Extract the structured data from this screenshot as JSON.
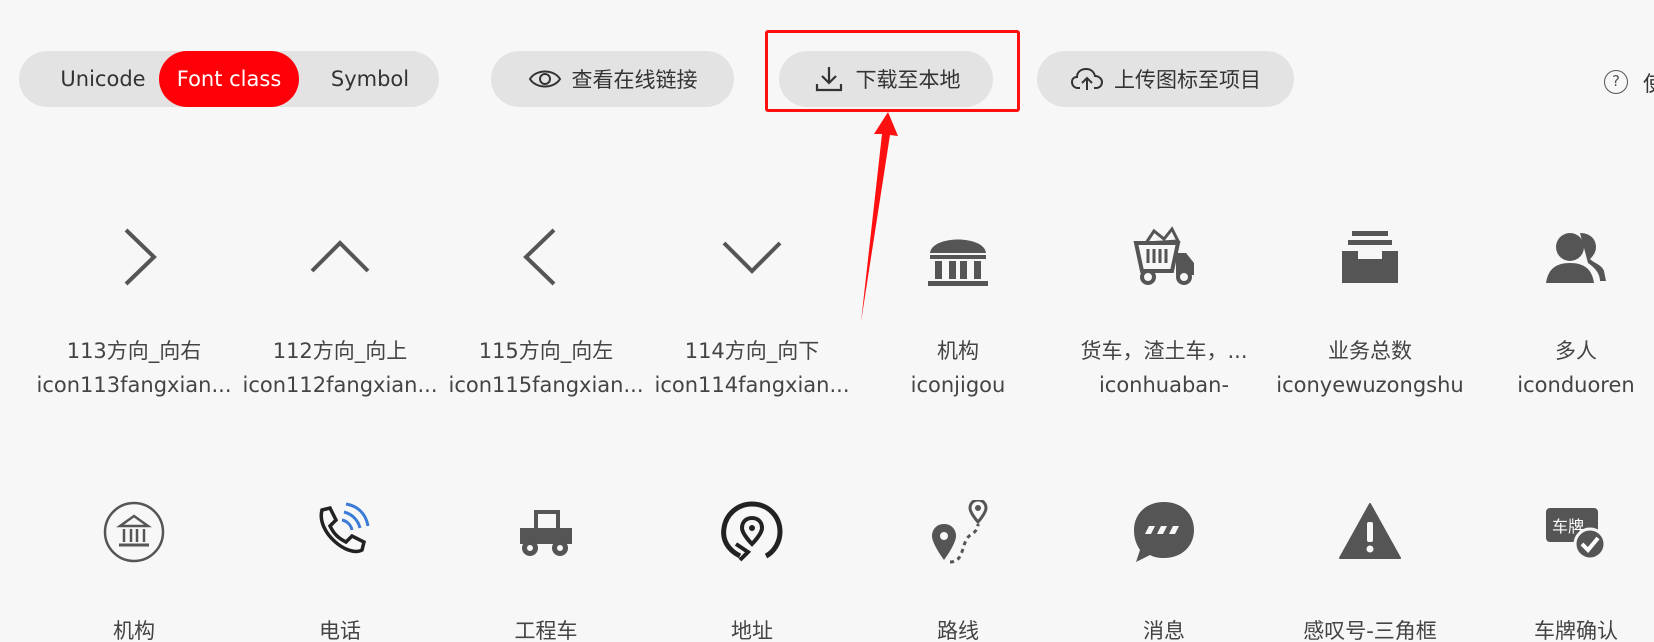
{
  "tabs": [
    {
      "label": "Unicode",
      "active": false
    },
    {
      "label": "Font class",
      "active": true
    },
    {
      "label": "Symbol",
      "active": false
    }
  ],
  "buttons": {
    "view_online": "查看在线链接",
    "download_local": "下载至本地",
    "upload_project": "上传图标至项目"
  },
  "help": {
    "symbol": "?",
    "text": "使"
  },
  "colors": {
    "accent": "#ff0008",
    "annotation": "#ff1010",
    "icon": "#555555",
    "pill_bg": "#e3e3e3"
  },
  "icons_row1": [
    {
      "name": "113方向_向右",
      "class": "icon113fangxian...",
      "icon": "chevron-right-icon"
    },
    {
      "name": "112方向_向上",
      "class": "icon112fangxian...",
      "icon": "chevron-up-icon"
    },
    {
      "name": "115方向_向左",
      "class": "icon115fangxian...",
      "icon": "chevron-left-icon"
    },
    {
      "name": "114方向_向下",
      "class": "icon114fangxian...",
      "icon": "chevron-down-icon"
    },
    {
      "name": "机构",
      "class": "iconjigou",
      "icon": "institution-icon"
    },
    {
      "name": "货车，渣土车，...",
      "class": "iconhuaban-",
      "icon": "dump-truck-icon"
    },
    {
      "name": "业务总数",
      "class": "iconyewuzongshu",
      "icon": "inbox-tray-icon"
    },
    {
      "name": "多人",
      "class": "iconduoren",
      "icon": "multi-user-icon"
    }
  ],
  "icons_row2": [
    {
      "name": "机构",
      "icon": "institution-circle-icon"
    },
    {
      "name": "电话",
      "icon": "phone-signal-icon"
    },
    {
      "name": "工程车",
      "icon": "tractor-icon"
    },
    {
      "name": "地址",
      "icon": "location-circle-icon"
    },
    {
      "name": "路线",
      "icon": "route-icon"
    },
    {
      "name": "消息",
      "icon": "message-bubble-icon"
    },
    {
      "name": "感叹号-三角框",
      "icon": "warning-triangle-icon"
    },
    {
      "name": "车牌确认",
      "icon": "license-plate-check-icon",
      "plate_text": "车牌"
    }
  ]
}
